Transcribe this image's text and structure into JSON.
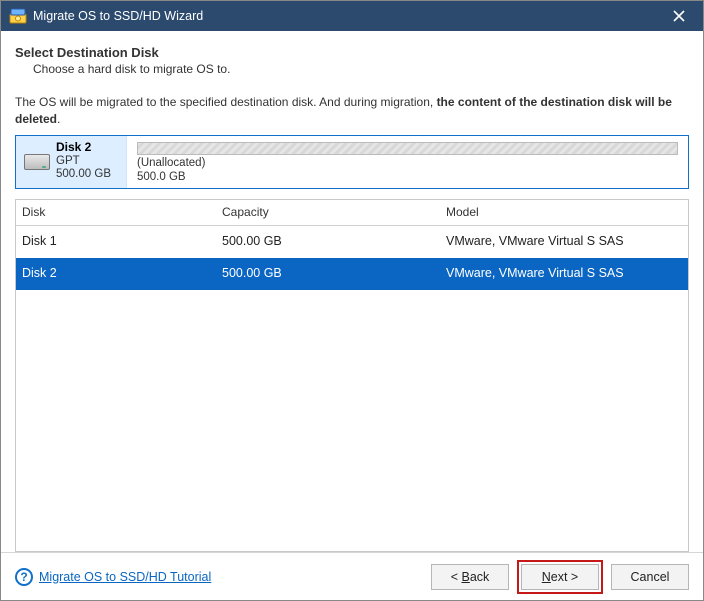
{
  "titlebar": {
    "title": "Migrate OS to SSD/HD Wizard"
  },
  "page": {
    "heading": "Select Destination Disk",
    "subheading": "Choose a hard disk to migrate OS to.",
    "warning_prefix": "The OS will be migrated to the specified destination disk. And during migration, ",
    "warning_bold": "the content of the destination disk will be deleted",
    "warning_suffix": "."
  },
  "selected_disk": {
    "name": "Disk 2",
    "scheme": "GPT",
    "size": "500.00 GB",
    "alloc_label": "(Unallocated)",
    "alloc_size": "500.0 GB"
  },
  "table": {
    "columns": {
      "disk": "Disk",
      "capacity": "Capacity",
      "model": "Model"
    },
    "rows": [
      {
        "disk": "Disk 1",
        "capacity": "500.00 GB",
        "model": "VMware, VMware Virtual S SAS",
        "selected": false
      },
      {
        "disk": "Disk 2",
        "capacity": "500.00 GB",
        "model": "VMware, VMware Virtual S SAS",
        "selected": true
      }
    ]
  },
  "footer": {
    "help_link": "Migrate OS to SSD/HD Tutorial",
    "back_prefix": "< ",
    "back_u": "B",
    "back_rest": "ack",
    "next_u": "N",
    "next_rest": "ext >",
    "cancel": "Cancel"
  }
}
